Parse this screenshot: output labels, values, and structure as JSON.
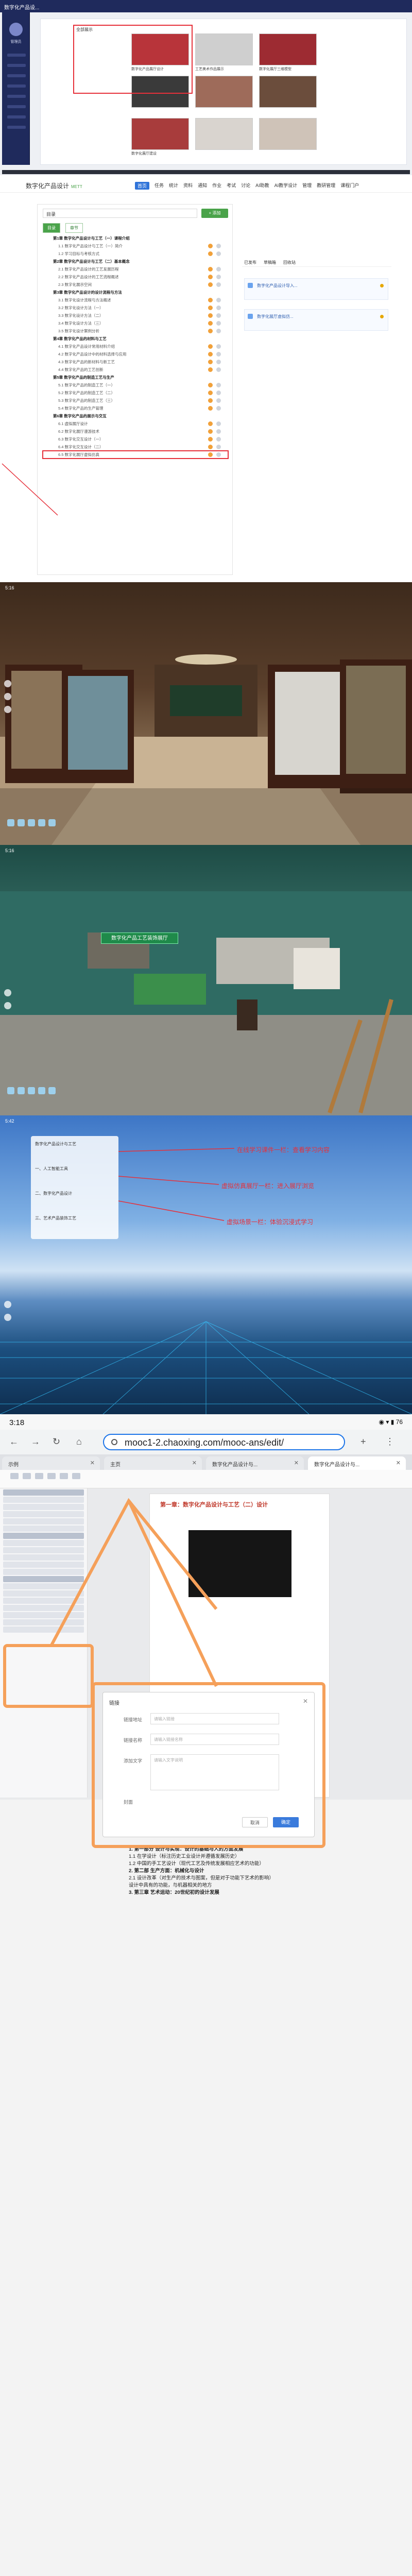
{
  "section1": {
    "app_title": "数字化产品设...",
    "sidebar_user": "管理员",
    "highlight_caption": "全部展示",
    "cards": [
      {
        "caption": "数字化产品展厅设计",
        "color": "#b8343a"
      },
      {
        "caption": "工艺美术作品展示",
        "color": "#cfcfcf"
      },
      {
        "caption": "数字化展厅三维模型",
        "color": "#9d2b32"
      },
      {
        "caption": "",
        "color": "#3a3a3a"
      },
      {
        "caption": "",
        "color": "#9e6b5a"
      },
      {
        "caption": "",
        "color": "#6b4d3c"
      },
      {
        "caption": "数字化展厅建设",
        "color": "#a83c3c"
      },
      {
        "caption": "",
        "color": "#d9d4cf"
      },
      {
        "caption": "",
        "color": "#cfc3b8"
      }
    ]
  },
  "section2": {
    "brand": "数字化产品设计",
    "brand_sub": "METT",
    "nav": [
      "首页",
      "任务",
      "统计",
      "资料",
      "通知",
      "作业",
      "考试",
      "讨论",
      "AI助教",
      "AI教学设计",
      "管理",
      "教研管理",
      "课程门户"
    ],
    "search_value": "目录",
    "add_button": "+ 添加",
    "tabs": [
      "目录",
      "章节"
    ],
    "outline": [
      {
        "kind": "ch",
        "text": "第1章 数字化产品设计与工艺（一）课程介绍"
      },
      {
        "kind": "it",
        "text": "1.1 数字化产品设计与工艺（一）简介"
      },
      {
        "kind": "it",
        "text": "1.2 学习目标与考核方式"
      },
      {
        "kind": "ch",
        "text": "第2章 数字化产品设计与工艺（二）基本概念"
      },
      {
        "kind": "it",
        "text": "2.1 数字化产品设计的工艺发展历程"
      },
      {
        "kind": "it",
        "text": "2.2 数字化产品设计的工艺流程概述"
      },
      {
        "kind": "it",
        "text": "2.3 数字化展示空间"
      },
      {
        "kind": "ch",
        "text": "第3章 数字化产品设计的设计流程与方法"
      },
      {
        "kind": "it",
        "text": "3.1 数字化设计流程与方法概述"
      },
      {
        "kind": "it",
        "text": "3.2 数字化设计方法（一）"
      },
      {
        "kind": "it",
        "text": "3.3 数字化设计方法（二）"
      },
      {
        "kind": "it",
        "text": "3.4 数字化设计方法（三）"
      },
      {
        "kind": "it",
        "text": "3.5 数字化设计案例分析"
      },
      {
        "kind": "ch",
        "text": "第4章 数字化产品的材料与工艺"
      },
      {
        "kind": "it",
        "text": "4.1 数字化产品设计常用材料介绍"
      },
      {
        "kind": "it",
        "text": "4.2 数字化产品设计中的材料选择与应用"
      },
      {
        "kind": "it",
        "text": "4.3 数字化产品的新材料与新工艺"
      },
      {
        "kind": "it",
        "text": "4.4 数字化产品的工艺创新"
      },
      {
        "kind": "ch",
        "text": "第5章 数字化产品的制造工艺与生产"
      },
      {
        "kind": "it",
        "text": "5.1 数字化产品的制造工艺（一）"
      },
      {
        "kind": "it",
        "text": "5.2 数字化产品的制造工艺（二）"
      },
      {
        "kind": "it",
        "text": "5.3 数字化产品的制造工艺（三）"
      },
      {
        "kind": "it",
        "text": "5.4 数字化产品的生产管理"
      },
      {
        "kind": "ch",
        "text": "第6章 数字化产品的展示与交互"
      },
      {
        "kind": "it",
        "text": "6.1 虚拟展厅设计"
      },
      {
        "kind": "it",
        "text": "6.2 数字化展厅漫游技术"
      },
      {
        "kind": "it",
        "text": "6.3 数字化交互设计（一）"
      },
      {
        "kind": "it",
        "text": "6.4 数字化交互设计（二）"
      },
      {
        "kind": "hl",
        "text": "6.5 数字化展厅虚拟仿真"
      }
    ],
    "side_tabs": [
      "已发布",
      "草稿箱",
      "回收站"
    ],
    "side_cards": [
      "数字化产品设计导入...",
      "数字化展厅虚拟仿..."
    ]
  },
  "section3": {
    "time": "5:16"
  },
  "section4": {
    "time": "5:16",
    "sign": "数字化产品工艺装饰展厅"
  },
  "section5": {
    "time": "5:42",
    "menu": [
      "数字化产品设计与工艺",
      "一、人工智能工具",
      "二、数字化产品设计",
      "三、艺术产品装饰工艺"
    ],
    "notes": [
      "在线学习课件一栏：查看学习内容",
      "虚拟仿真展厅一栏：进入展厅浏览",
      "虚拟场景一栏：体验沉浸式学习"
    ]
  },
  "section6": {
    "time": "3:18",
    "status_right": "◉ ▾ ▮ 76",
    "url": "mooc1-2.chaoxing.com/mooc-ans/edit/",
    "tabs": [
      "示例",
      "主页",
      "数字化产品设计与...",
      "数字化产品设计与..."
    ],
    "page_title": "第一章：数字化产品设计与工艺（二）设计",
    "modal": {
      "title": "链接",
      "fields": [
        {
          "label": "链接地址",
          "placeholder": "请输入链接"
        },
        {
          "label": "链接名称",
          "placeholder": "请输入链接名称"
        },
        {
          "label": "添加文字",
          "placeholder": "请输入文字说明"
        }
      ],
      "image_label": "封面",
      "cancel": "取消",
      "confirm": "确定"
    },
    "notes": [
      "1. 第一部分 设计与实现：设计的基础与人的方面发展",
      "1.1 在学设计（标注历史工业设计并遵循发展历史）",
      "1.2 中国的手工艺设计（现代工艺及传统发展相应艺术的功能）",
      "2. 第二部 生产方面：机械化与设计",
      "2.1 设计改革（对生产的技术与图案，但是对于功能下艺术的影响）",
      "设计中具有的功能，与机器相关的地方",
      "3. 第三章 艺术运动：20世纪初的设计发展"
    ]
  }
}
